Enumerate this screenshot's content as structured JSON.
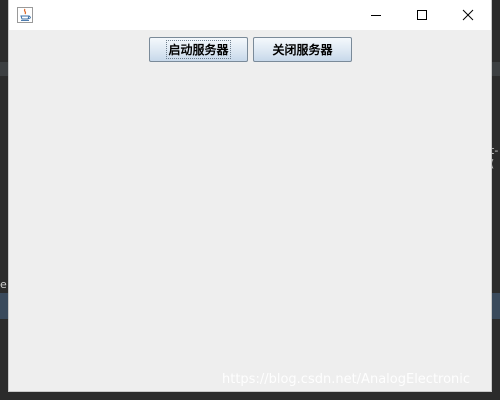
{
  "window": {
    "title": ""
  },
  "buttons": {
    "start_label": "启动服务器",
    "stop_label": "关闭服务器"
  },
  "icons": {
    "app": "java-app-icon",
    "minimize": "minimize-icon",
    "maximize": "maximize-icon",
    "close": "close-icon"
  },
  "background": {
    "left_fragment": "e",
    "right_fragment": "t- ("
  },
  "watermark": "https://blog.csdn.net/AnalogElectronic",
  "colors": {
    "window_bg": "#eeeeee",
    "titlebar_bg": "#ffffff",
    "backdrop": "#2b2b2b"
  }
}
